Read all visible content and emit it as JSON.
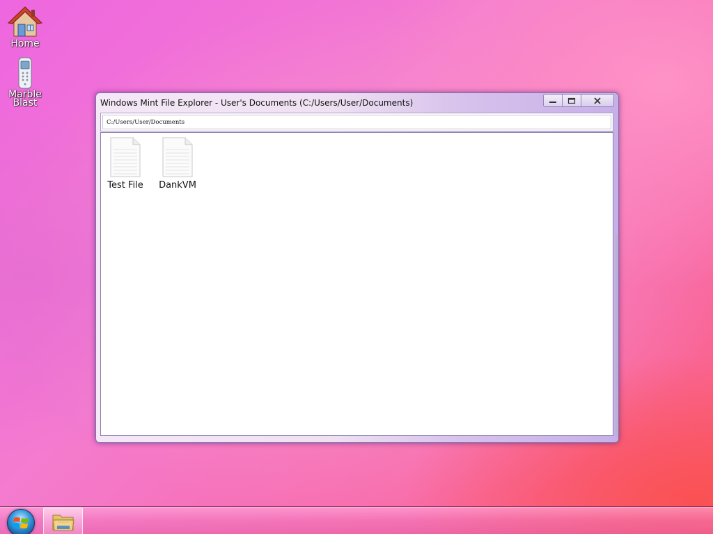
{
  "desktop": {
    "icons": [
      {
        "label": "Home",
        "icon": "house-icon"
      },
      {
        "label": "Marble Blast",
        "icon": "phone-icon"
      }
    ]
  },
  "window": {
    "title": "Windows Mint File Explorer - User's Documents (C:/Users/User/Documents)",
    "address": "C:/Users/User/Documents",
    "controls": [
      "minimize-icon",
      "maximize-icon",
      "close-icon"
    ],
    "files": [
      {
        "name": "Test File",
        "icon": "document-icon"
      },
      {
        "name": "DankVM",
        "icon": "document-icon"
      }
    ]
  },
  "taskbar": {
    "start_icon": "windows-logo-icon",
    "pinned": [
      {
        "icon": "folder-icon",
        "app": "file-explorer"
      }
    ]
  },
  "colors": {
    "desktop_pink": "#f47bcf",
    "desktop_red": "#fb5f7a",
    "window_frame": "#c6b0e8",
    "start_blue": "#3a9be0"
  }
}
